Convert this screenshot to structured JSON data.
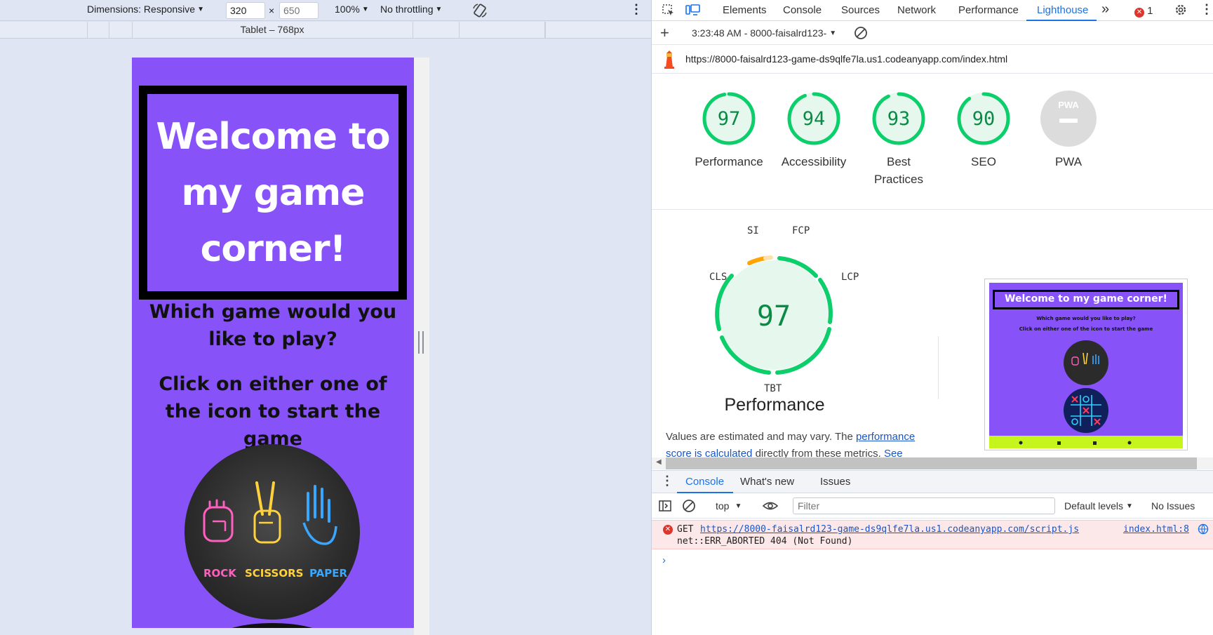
{
  "device_toolbar": {
    "dimensions_label": "Dimensions: Responsive",
    "width": "320",
    "height_placeholder": "650",
    "times": "×",
    "zoom": "100%",
    "throttling": "No throttling",
    "breakpoint_label": "Tablet – 768px"
  },
  "page": {
    "hero_title": "Welcome to my game corner!",
    "question": "Which game would you like to play?",
    "instruction": "Click on either one of the icon to start the game",
    "rps": {
      "rock": "ROCK",
      "scissors": "SCISSORS",
      "paper": "PAPER"
    }
  },
  "devtools": {
    "tabs": [
      "Elements",
      "Console",
      "Sources",
      "Network",
      "Performance",
      "Lighthouse"
    ],
    "more_tabs": "»",
    "error_count": "1",
    "lighthouse_report": "3:23:48 AM - 8000-faisalrd123-",
    "url": "https://8000-faisalrd123-game-ds9qlfe7la.us1.codeanyapp.com/index.html",
    "scores": [
      {
        "value": "97",
        "label": "Performance",
        "fraction": 0.97
      },
      {
        "value": "94",
        "label": "Accessibility",
        "fraction": 0.94
      },
      {
        "value": "93",
        "label": "Best Practices",
        "fraction": 0.93
      },
      {
        "value": "90",
        "label": "SEO",
        "fraction": 0.9
      },
      {
        "value": "PWA",
        "label": "PWA"
      }
    ],
    "perf": {
      "score": "97",
      "title": "Performance",
      "metrics": {
        "si": "SI",
        "fcp": "FCP",
        "cls": "CLS",
        "lcp": "LCP",
        "tbt": "TBT"
      },
      "note_prefix": "Values are estimated and may vary. The ",
      "note_link": "performance score is calculated",
      "note_suffix": " directly from these metrics. ",
      "note_see": "See"
    },
    "thumbnail": {
      "title": "Welcome to my game corner!",
      "sub1": "Which game would you like to play?",
      "sub2": "Click on either one of the icon to start the game"
    },
    "drawer_tabs": [
      "Console",
      "What's new",
      "Issues"
    ],
    "console": {
      "context": "top",
      "filter_placeholder": "Filter",
      "levels": "Default levels",
      "issues": "No Issues",
      "error_method": "GET",
      "error_url": "https://8000-faisalrd123-game-ds9qlfe7la.us1.codeanyapp.com/script.js",
      "error_source": "index.html:8",
      "error_detail": "net::ERR_ABORTED 404 (Not Found)",
      "prompt": "›"
    }
  },
  "colors": {
    "page_bg": "#8752f7",
    "score_green": "#0cce6b",
    "accent_blue": "#1a73e8",
    "error_red": "#dc362e"
  }
}
